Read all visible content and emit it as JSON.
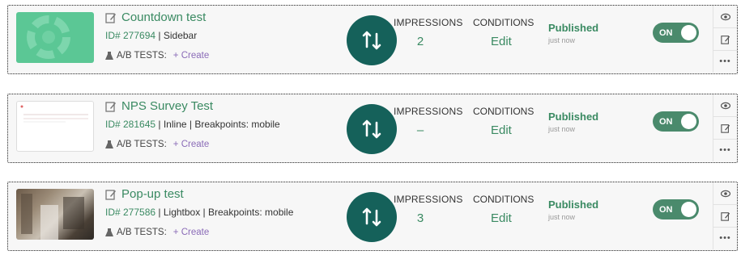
{
  "cards": [
    {
      "title": "Countdown test",
      "id_label": "ID# 277694",
      "details": " | Sidebar",
      "ab_label": "A/B TESTS:",
      "create_label": "+ Create",
      "impressions_label": "IMPRESSIONS",
      "impressions_value": "2",
      "conditions_label": "CONDITIONS",
      "conditions_value": "Edit",
      "status": "Published",
      "status_time": "just now",
      "toggle": "ON"
    },
    {
      "title": "NPS Survey Test",
      "id_label": "ID# 281645",
      "details": " | Inline | Breakpoints: mobile",
      "ab_label": "A/B TESTS:",
      "create_label": "+ Create",
      "impressions_label": "IMPRESSIONS",
      "impressions_value": "–",
      "conditions_label": "CONDITIONS",
      "conditions_value": "Edit",
      "status": "Published",
      "status_time": "just now",
      "toggle": "ON"
    },
    {
      "title": "Pop-up test",
      "id_label": "ID# 277586",
      "details": " | Lightbox | Breakpoints: mobile",
      "ab_label": "A/B TESTS:",
      "create_label": "+ Create",
      "impressions_label": "IMPRESSIONS",
      "impressions_value": "3",
      "conditions_label": "CONDITIONS",
      "conditions_value": "Edit",
      "status": "Published",
      "status_time": "just now",
      "toggle": "ON"
    }
  ],
  "colors": {
    "accent": "#3a8a62",
    "swap_button": "#15615a",
    "toggle_on": "#4a8a6c",
    "create_link": "#8a6bb7"
  },
  "icons": [
    "edit-icon",
    "flask-icon",
    "swap-vertical-icon",
    "eye-icon",
    "more-icon"
  ]
}
